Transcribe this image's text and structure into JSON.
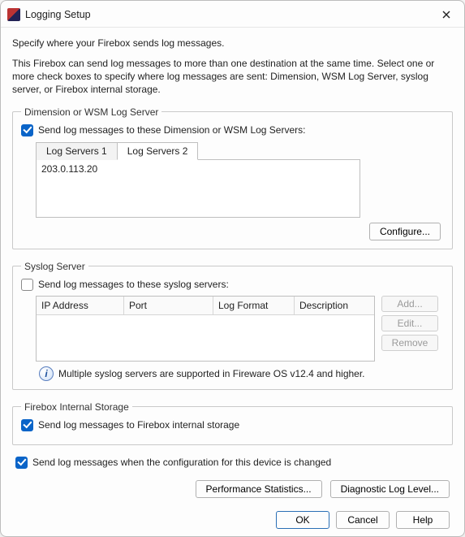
{
  "window": {
    "title": "Logging Setup"
  },
  "intro": {
    "line1": "Specify where your Firebox sends log messages.",
    "line2": "This Firebox can send log messages to more than one destination at the same time. Select one or more check boxes to specify where log messages are sent: Dimension, WSM Log Server, syslog server, or Firebox internal storage."
  },
  "wsm": {
    "legend": "Dimension or WSM Log Server",
    "checkbox_label": "Send log messages to these Dimension or WSM Log Servers:",
    "checked": true,
    "tabs": [
      "Log Servers 1",
      "Log Servers 2"
    ],
    "active_tab": 1,
    "panel_text": "203.0.113.20",
    "configure_label": "Configure..."
  },
  "syslog": {
    "legend": "Syslog Server",
    "checkbox_label": "Send log messages to these syslog servers:",
    "checked": false,
    "columns": {
      "ip": "IP Address",
      "port": "Port",
      "format": "Log Format",
      "description": "Description"
    },
    "buttons": {
      "add": "Add...",
      "edit": "Edit...",
      "remove": "Remove"
    },
    "info": "Multiple syslog servers are supported in Fireware OS v12.4 and higher."
  },
  "internal": {
    "legend": "Firebox Internal Storage",
    "checkbox_label": "Send log messages to Firebox internal storage",
    "checked": true
  },
  "config_change": {
    "checkbox_label": "Send log messages when the configuration for this device is changed",
    "checked": true
  },
  "bottom_buttons": {
    "perf": "Performance Statistics...",
    "diag": "Diagnostic Log Level..."
  },
  "dialog_buttons": {
    "ok": "OK",
    "cancel": "Cancel",
    "help": "Help"
  }
}
